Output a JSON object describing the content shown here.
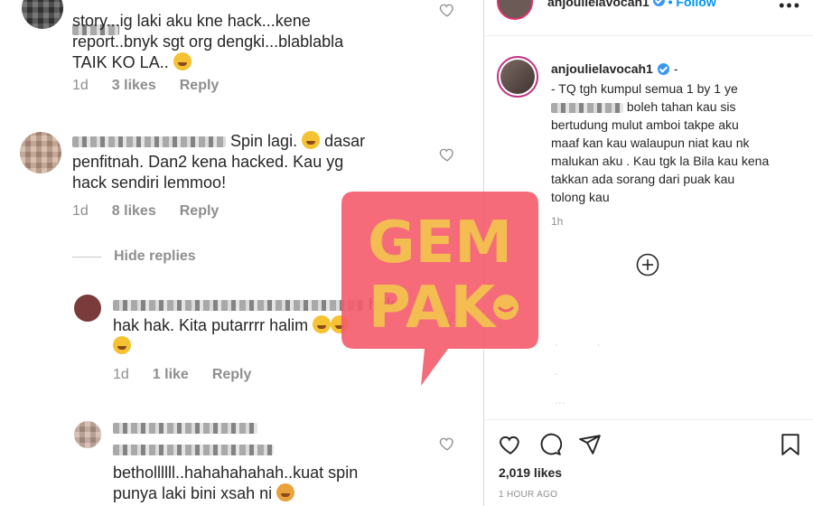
{
  "comments": [
    {
      "text": "story...ig laki aku kne hack...kene\nreport..bnyk sgt org dengki...blablabla\nTAIK KO LA..",
      "time": "1d",
      "likes": "3 likes",
      "reply": "Reply"
    },
    {
      "text": "Spin lagi.",
      "text_b": "dasar\npenfitnah. Dan2 kena hacked. Kau yg\nhack sendiri lemmoo!",
      "time": "1d",
      "likes": "8 likes",
      "reply": "Reply"
    }
  ],
  "hide_replies": "Hide replies",
  "replies": [
    {
      "text_a": "hak",
      "text_b": "hak hak. Kita putarrrr halim",
      "time": "1d",
      "likes": "1 like",
      "reply": "Reply"
    },
    {
      "text": "bethollllll..hahahahahah..kuat spin\npunya laki bini xsah ni"
    }
  ],
  "logo": {
    "line1": "GEM",
    "line2": "PAK",
    "bg": "#f45b6c",
    "fg": "#f4c64d"
  },
  "post": {
    "top_username": "anjoulielavocah1",
    "follow_label": "• Follow",
    "caption_username": "anjoulielavocah1",
    "caption_suffix": "-",
    "caption_line1": "- TQ tgh kumpul semua 1 by 1 ye",
    "caption_rest": "boleh tahan kau sis\nbertudung mulut amboi takpe aku\nmaaf kan kau walaupun niat kau nk\nmalukan aku . Kau tgk la Bila kau kena\ntakkan ada sorang dari puak kau\ntolong kau",
    "caption_time": "1h",
    "likes": "2,019 likes",
    "time": "1 HOUR AGO"
  },
  "icons": [
    "heart-icon",
    "comment-icon",
    "share-icon",
    "bookmark-icon",
    "plus-circle-icon",
    "more-icon",
    "verified-icon"
  ],
  "colors": {
    "link": "#0095f6",
    "muted": "#8e8e8e",
    "text": "#262626",
    "verified": "#3897f0"
  }
}
